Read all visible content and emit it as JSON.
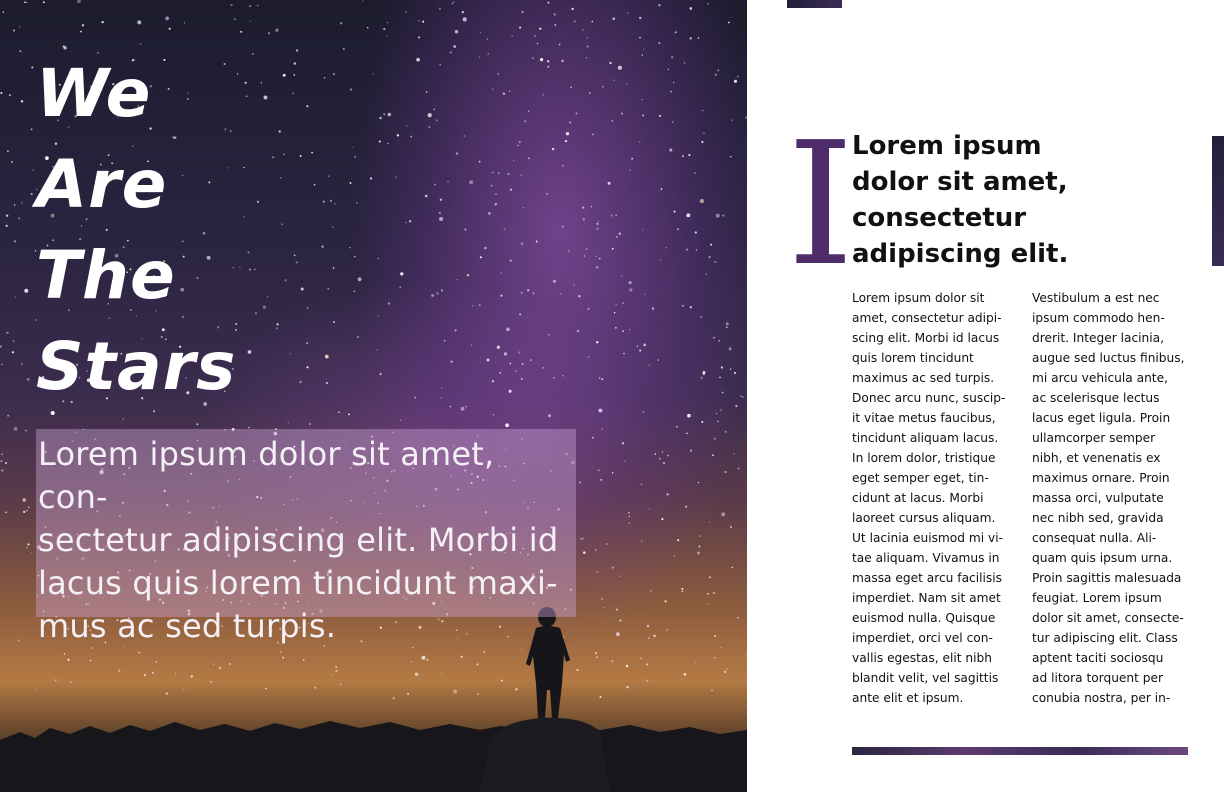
{
  "left_page": {
    "title_lines": [
      "We",
      "Are",
      "The",
      "Stars"
    ],
    "intro": "Lorem ipsum dolor sit amet, con-\nsectetur adipiscing elit. Morbi id\nlacus quis lorem tincidunt maxi-\nmus ac sed turpis."
  },
  "right_page": {
    "drop_cap": "I",
    "headline": "Lorem ipsum dolor sit amet, consectetur adipiscing elit.",
    "column_1": "Lorem ipsum dolor sit\namet, consectetur adipi-\nscing elit. Morbi id lacus\nquis lorem tincidunt\nmaximus ac sed turpis.\nDonec arcu nunc, suscip-\nit vitae metus faucibus,\ntincidunt aliquam lacus.\nIn lorem dolor, tristique\neget semper eget, tin-\ncidunt at lacus. Morbi\nlaoreet cursus aliquam.\nUt lacinia euismod mi vi-\ntae aliquam. Vivamus in\nmassa eget arcu facilisis\nimperdiet. Nam sit amet\neuismod nulla. Quisque\nimperdiet, orci vel con-\nvallis egestas, elit nibh\nblandit velit, vel sagittis\nante elit et ipsum.",
    "column_2": "Vestibulum a est nec\nipsum commodo hen-\ndrerit. Integer lacinia,\naugue sed luctus finibus,\nmi arcu vehicula ante,\nac scelerisque lectus\nlacus eget ligula. Proin\nullamcorper semper\nnibh, et venenatis ex\nmaximus ornare. Proin\nmassa orci, vulputate\nnec nibh sed, gravida\nconsequat nulla. Ali-\nquam quis ipsum urna.\nProin sagittis malesuada\nfeugiat. Lorem ipsum\ndolor sit amet, consecte-\ntur adipiscing elit. Class\naptent taciti sociosqu\nad litora torquent per\nconubia nostra, per in-"
  },
  "colors": {
    "accent_purple": "#4e2d6a",
    "text_dark": "#111111",
    "title_white": "#ffffff"
  }
}
